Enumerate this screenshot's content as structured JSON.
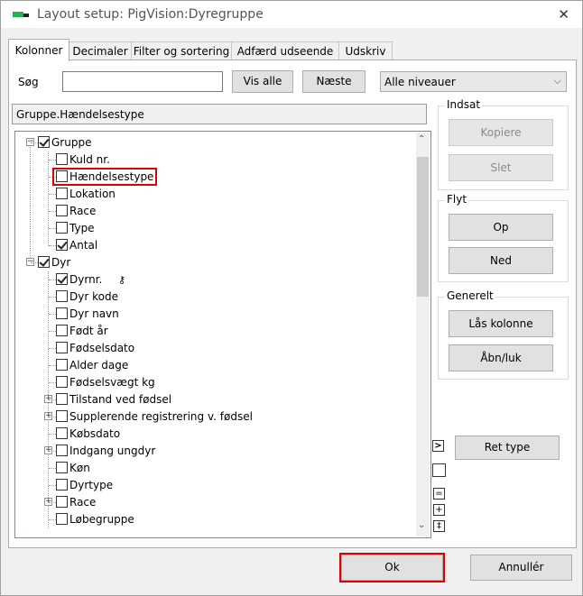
{
  "window": {
    "title": "Layout setup: PigVision:Dyregruppe"
  },
  "tabs": [
    "Kolonner",
    "Decimaler",
    "Filter og sortering",
    "Adfærd  udseende",
    "Udskriv"
  ],
  "search": {
    "label": "Søg",
    "value": "",
    "show_all": "Vis alle",
    "next": "Næste",
    "level": "Alle niveauer"
  },
  "selected_path": "Gruppe.Hændelsestype",
  "tree": [
    {
      "label": "Gruppe",
      "level": 0,
      "checked": true,
      "expander": "minus"
    },
    {
      "label": "Kuld nr.",
      "level": 1,
      "checked": false
    },
    {
      "label": "Hændelsestype",
      "level": 1,
      "checked": false,
      "highlight": true
    },
    {
      "label": "Lokation",
      "level": 1,
      "checked": false
    },
    {
      "label": "Race",
      "level": 1,
      "checked": false
    },
    {
      "label": "Type",
      "level": 1,
      "checked": false
    },
    {
      "label": "Antal",
      "level": 1,
      "checked": true
    },
    {
      "label": "Dyr",
      "level": 0,
      "checked": true,
      "expander": "minus"
    },
    {
      "label": "Dyrnr.",
      "level": 1,
      "checked": true,
      "icon": "key-icon"
    },
    {
      "label": "Dyr kode",
      "level": 1,
      "checked": false
    },
    {
      "label": "Dyr navn",
      "level": 1,
      "checked": false
    },
    {
      "label": "Født år",
      "level": 1,
      "checked": false
    },
    {
      "label": "Fødselsdato",
      "level": 1,
      "checked": false
    },
    {
      "label": "Alder dage",
      "level": 1,
      "checked": false
    },
    {
      "label": "Fødselsvægt kg",
      "level": 1,
      "checked": false
    },
    {
      "label": "Tilstand ved fødsel",
      "level": 1,
      "checked": false,
      "expander": "plus"
    },
    {
      "label": "Supplerende registrering v. fødsel",
      "level": 1,
      "checked": false,
      "expander": "plus"
    },
    {
      "label": "Købsdato",
      "level": 1,
      "checked": false
    },
    {
      "label": "Indgang ungdyr",
      "level": 1,
      "checked": false,
      "expander": "plus"
    },
    {
      "label": "Køn",
      "level": 1,
      "checked": false
    },
    {
      "label": "Dyrtype",
      "level": 1,
      "checked": false
    },
    {
      "label": "Race",
      "level": 1,
      "checked": false,
      "expander": "plus"
    },
    {
      "label": "Løbegruppe",
      "level": 1,
      "checked": false
    }
  ],
  "groups": {
    "indsat": {
      "title": "Indsat",
      "copy": "Kopiere",
      "delete": "Slet"
    },
    "flyt": {
      "title": "Flyt",
      "up": "Op",
      "down": "Ned"
    },
    "generelt": {
      "title": "Generelt",
      "lock": "Lås kolonne",
      "toggle": "Åbn/luk"
    }
  },
  "right_tools": {
    "arrow": ">",
    "ret_type": "Ret type",
    "equals": "=",
    "plus": "+",
    "plusminus": "‡"
  },
  "footer": {
    "ok": "Ok",
    "cancel": "Annullér"
  }
}
